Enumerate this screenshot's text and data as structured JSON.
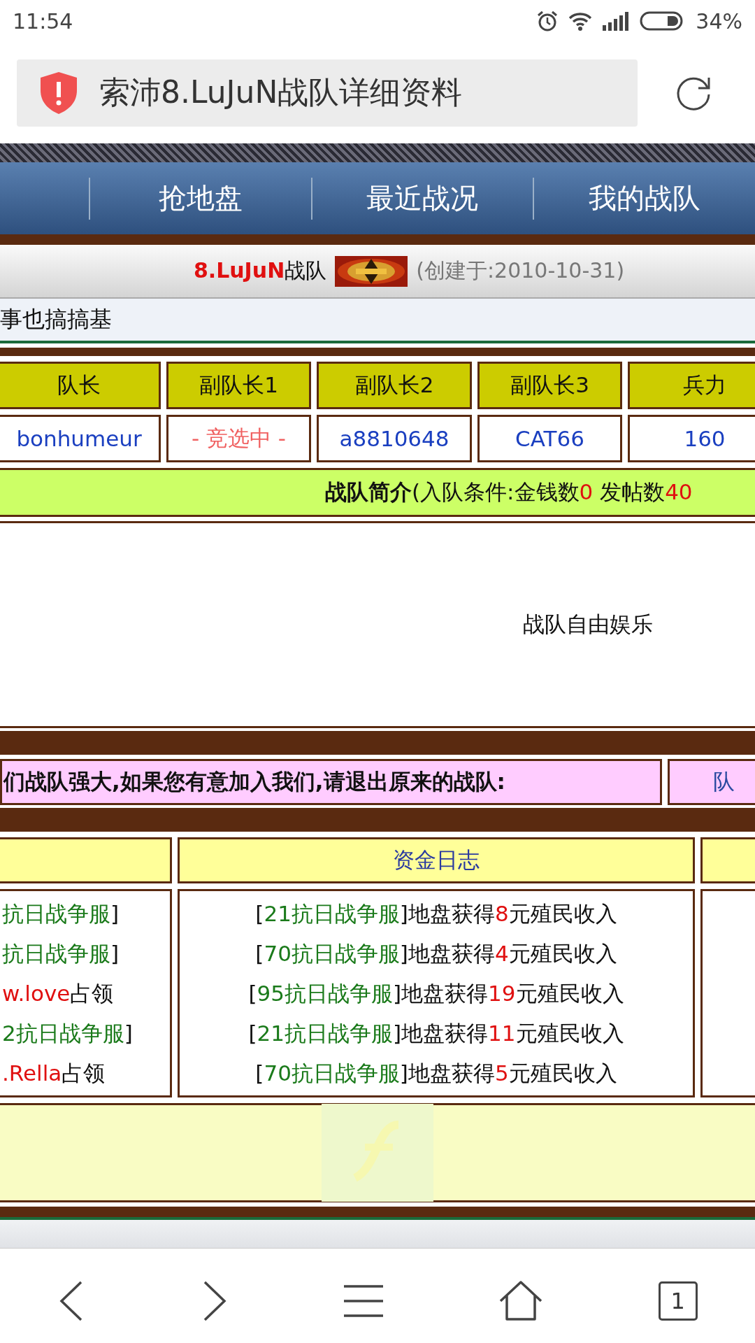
{
  "status_bar": {
    "time": "11:54",
    "battery": "34%"
  },
  "address_bar": {
    "title": "索沛8.LuJuN战队详细资料"
  },
  "nav_tabs": [
    "抢地盘",
    "最近战况",
    "我的战队"
  ],
  "team_header": {
    "team": "8.LuJuN",
    "suffix": "战队",
    "created": "(创建于:2010-10-31)"
  },
  "motto": "事也搞搞基",
  "officers": {
    "columns": [
      "队长",
      "副队长1",
      "副队长2",
      "副队长3",
      "兵力"
    ],
    "values": [
      {
        "text": "bonhumeur",
        "kind": "name"
      },
      {
        "text": "- 竞选中 -",
        "kind": "vacant"
      },
      {
        "text": "a8810648",
        "kind": "name"
      },
      {
        "text": "CAT66",
        "kind": "name"
      },
      {
        "text": "160",
        "kind": "name"
      }
    ]
  },
  "intro": {
    "title": "战队简介",
    "parts": [
      {
        "text": "(入队条件:金钱数",
        "kind": "plain"
      },
      {
        "text": "0",
        "kind": "amount"
      },
      {
        "text": " 发帖数",
        "kind": "plain"
      },
      {
        "text": "40",
        "kind": "amount"
      }
    ],
    "body": "战队自由娱乐"
  },
  "recruit": {
    "message": "们战队强大,如果您有意加入我们,请退出原来的战队:",
    "members_link": "队"
  },
  "logs": {
    "column_1": [
      [
        {
          "text": "抗日战争服",
          "kind": "server"
        },
        {
          "text": "]",
          "kind": "plain"
        }
      ],
      [
        {
          "text": "抗日战争服",
          "kind": "server"
        },
        {
          "text": "]",
          "kind": "plain"
        }
      ],
      [
        {
          "text": "w.love",
          "kind": "amount"
        },
        {
          "text": "占领",
          "kind": "plain"
        }
      ],
      [
        {
          "text": "2抗日战争服",
          "kind": "server"
        },
        {
          "text": "]",
          "kind": "plain"
        }
      ],
      [
        {
          "text": ".Rella",
          "kind": "amount"
        },
        {
          "text": "占领",
          "kind": "plain"
        }
      ]
    ],
    "fund_title": "资金日志",
    "fund_log": [
      [
        {
          "text": "[",
          "kind": "plain"
        },
        {
          "text": "21抗日战争服",
          "kind": "server"
        },
        {
          "text": "]地盘获得",
          "kind": "plain"
        },
        {
          "text": "8",
          "kind": "amount"
        },
        {
          "text": "元殖民收入",
          "kind": "plain"
        }
      ],
      [
        {
          "text": "[",
          "kind": "plain"
        },
        {
          "text": "70抗日战争服",
          "kind": "server"
        },
        {
          "text": "]地盘获得",
          "kind": "plain"
        },
        {
          "text": "4",
          "kind": "amount"
        },
        {
          "text": "元殖民收入",
          "kind": "plain"
        }
      ],
      [
        {
          "text": "[",
          "kind": "plain"
        },
        {
          "text": "95抗日战争服",
          "kind": "server"
        },
        {
          "text": "]地盘获得",
          "kind": "plain"
        },
        {
          "text": "19",
          "kind": "amount"
        },
        {
          "text": "元殖民收入",
          "kind": "plain"
        }
      ],
      [
        {
          "text": "[",
          "kind": "plain"
        },
        {
          "text": "21抗日战争服",
          "kind": "server"
        },
        {
          "text": "]地盘获得",
          "kind": "plain"
        },
        {
          "text": "11",
          "kind": "amount"
        },
        {
          "text": "元殖民收入",
          "kind": "plain"
        }
      ],
      [
        {
          "text": "[",
          "kind": "plain"
        },
        {
          "text": "70抗日战争服",
          "kind": "server"
        },
        {
          "text": "]地盘获得",
          "kind": "plain"
        },
        {
          "text": "5",
          "kind": "amount"
        },
        {
          "text": "元殖民收入",
          "kind": "plain"
        }
      ]
    ]
  },
  "bottom_nav": {
    "tab_count": "1"
  }
}
